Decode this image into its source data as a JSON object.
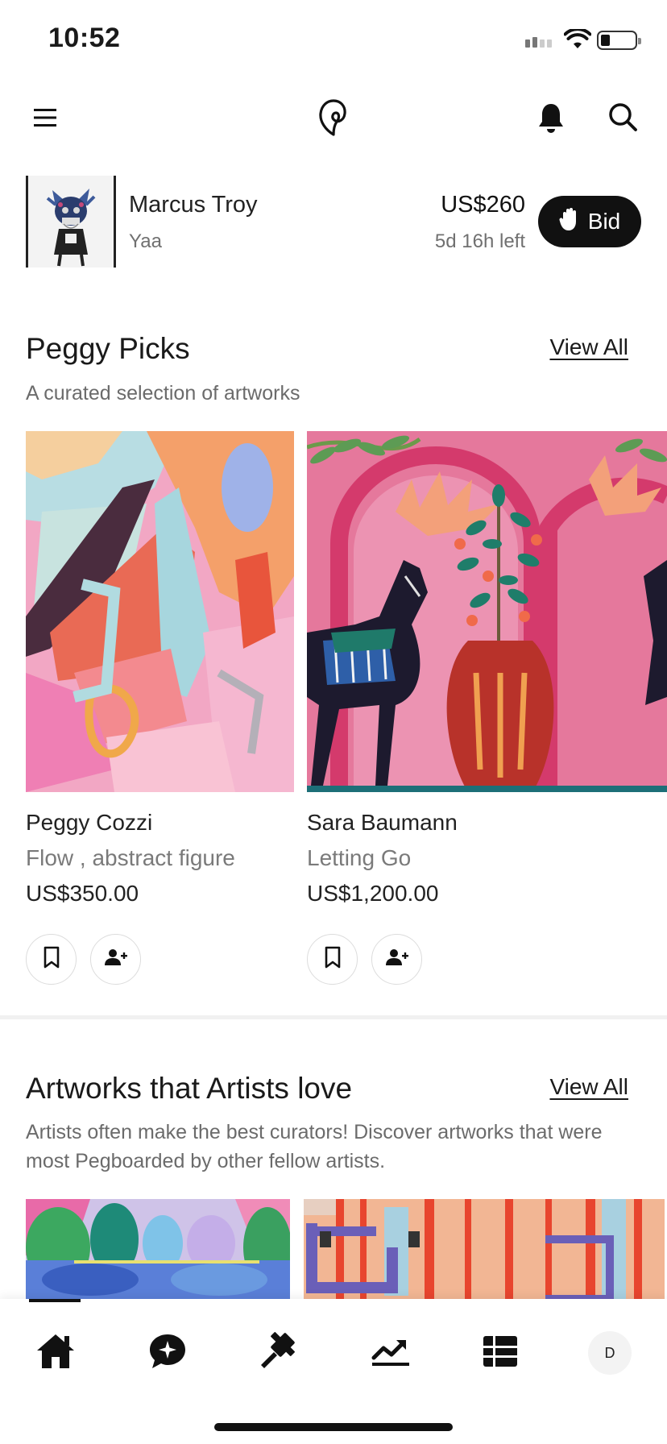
{
  "status": {
    "time": "10:52"
  },
  "auction": {
    "artist": "Marcus Troy",
    "title": "Yaa",
    "price": "US$260",
    "time_left": "5d 16h left",
    "bid_label": "Bid"
  },
  "peggy_picks": {
    "title": "Peggy Picks",
    "view_all": "View All",
    "subtitle": "A curated selection of artworks",
    "cards": [
      {
        "artist": "Peggy Cozzi",
        "title": "Flow , abstract figure",
        "price": "US$350.00"
      },
      {
        "artist": "Sara Baumann",
        "title": "Letting Go",
        "price": "US$1,200.00"
      }
    ]
  },
  "artists_love": {
    "title": "Artworks that Artists love",
    "view_all": "View All",
    "subtitle": "Artists often make the best curators! Discover artworks that were most Pegboarded by other fellow artists."
  },
  "tab_bar": {
    "tabs": [
      "home-icon",
      "chat-icon",
      "gavel-icon",
      "trending-icon",
      "list-icon",
      "profile-avatar"
    ],
    "active": "home",
    "avatar_initial": "D"
  }
}
